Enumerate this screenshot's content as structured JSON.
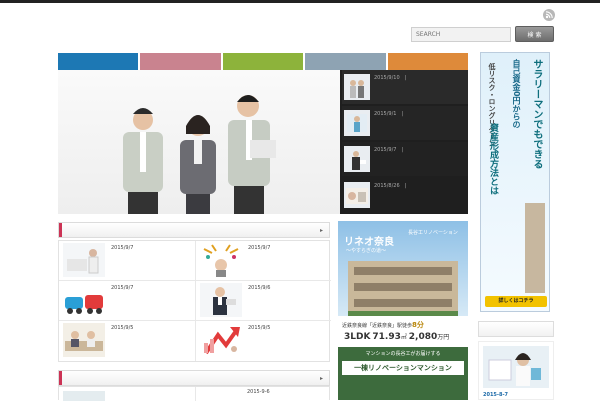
{
  "search": {
    "placeholder": "SEARCH",
    "button_label": "検 索"
  },
  "icons": {
    "rss": "rss-icon",
    "arrow": "chevron-right-icon"
  },
  "tabs": [
    {
      "color": "#1d78b4"
    },
    {
      "color": "#c9838f"
    },
    {
      "color": "#8db33b"
    },
    {
      "color": "#8ea3b3"
    },
    {
      "color": "#de8a3a"
    }
  ],
  "slider": {
    "thumbs": [
      {
        "date": "2015/9/10　|"
      },
      {
        "date": "2015/9/1　|"
      },
      {
        "date": "2015/9/7　|"
      },
      {
        "date": "2015/8/26　|"
      }
    ]
  },
  "section1": {
    "arrow": "▸"
  },
  "posts": [
    {
      "date": "2015/9/7"
    },
    {
      "date": "2015/9/7"
    },
    {
      "date": "2015/9/7"
    },
    {
      "date": "2015/9/6"
    },
    {
      "date": "2015/9/5"
    },
    {
      "date": "2015/9/5"
    }
  ],
  "section2": {
    "arrow": "▸",
    "first_date": "2015-9-6"
  },
  "ad_mid": {
    "title": "リネオ奈良",
    "subtitle": "〜やすらぎの道〜",
    "brand": "長谷工リノベーション",
    "line1_prefix": "近鉄奈良線「近鉄奈良」駅徒歩",
    "line1_num": "8分",
    "layout": "3LDK",
    "area": "71.93",
    "area_unit": "㎡",
    "price": "2,080",
    "price_unit": "万円",
    "green_line": "マンションの長谷工がお届けする",
    "green_title": "一棟リノベーションマンション"
  },
  "ad_side": {
    "col1": "サラリーマンでもできる",
    "col2": "自己資金0円からの",
    "col3": "低リスク・ロングリターン",
    "col4": "資産形成方法とは",
    "button": "詳しくはコチラ"
  },
  "side_post": {
    "date": "2015-8-7"
  }
}
